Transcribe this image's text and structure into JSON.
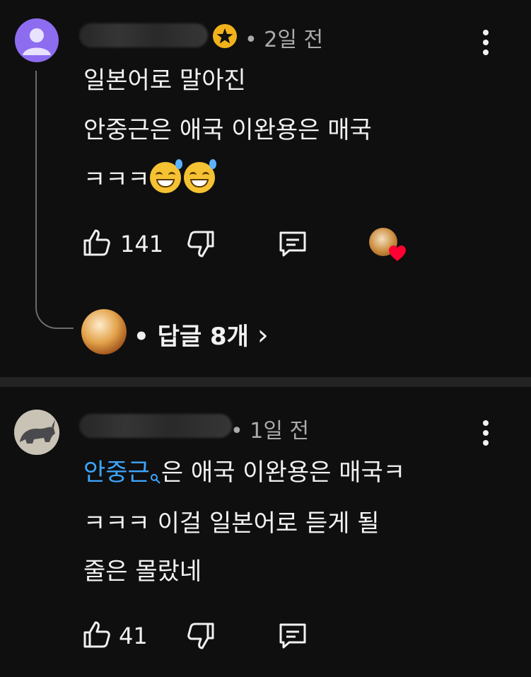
{
  "comments": [
    {
      "time": "• 2일 전",
      "lines": [
        "일본어로 말아진",
        "안중근은 애국 이완용은 매국",
        "ㅋㅋㅋ"
      ],
      "likes": "141",
      "replies_label": "• 답글 8개 ",
      "replies_chevron": "›",
      "icons": [
        "thumbs-up-icon",
        "thumbs-down-icon",
        "reply-icon",
        "creator-heart-icon",
        "more-vert-icon",
        "star-badge-icon"
      ]
    },
    {
      "time": "• 1일 전",
      "link_text": "안중근",
      "line1_rest": "은 애국 이완용은 매국ㅋ",
      "line2": "ㅋㅋㅋ 이걸 일본어로 듣게 될",
      "line3": "줄은 몰랐네",
      "likes": "41",
      "icons": [
        "thumbs-up-icon",
        "thumbs-down-icon",
        "reply-icon",
        "search-icon",
        "more-vert-icon"
      ]
    }
  ],
  "colors": {
    "background": "#0f0f0f",
    "link": "#3ea6ff",
    "meta": "#aaaaaa",
    "avatar1": "#8e6cf0",
    "heart": "#ff0033"
  }
}
